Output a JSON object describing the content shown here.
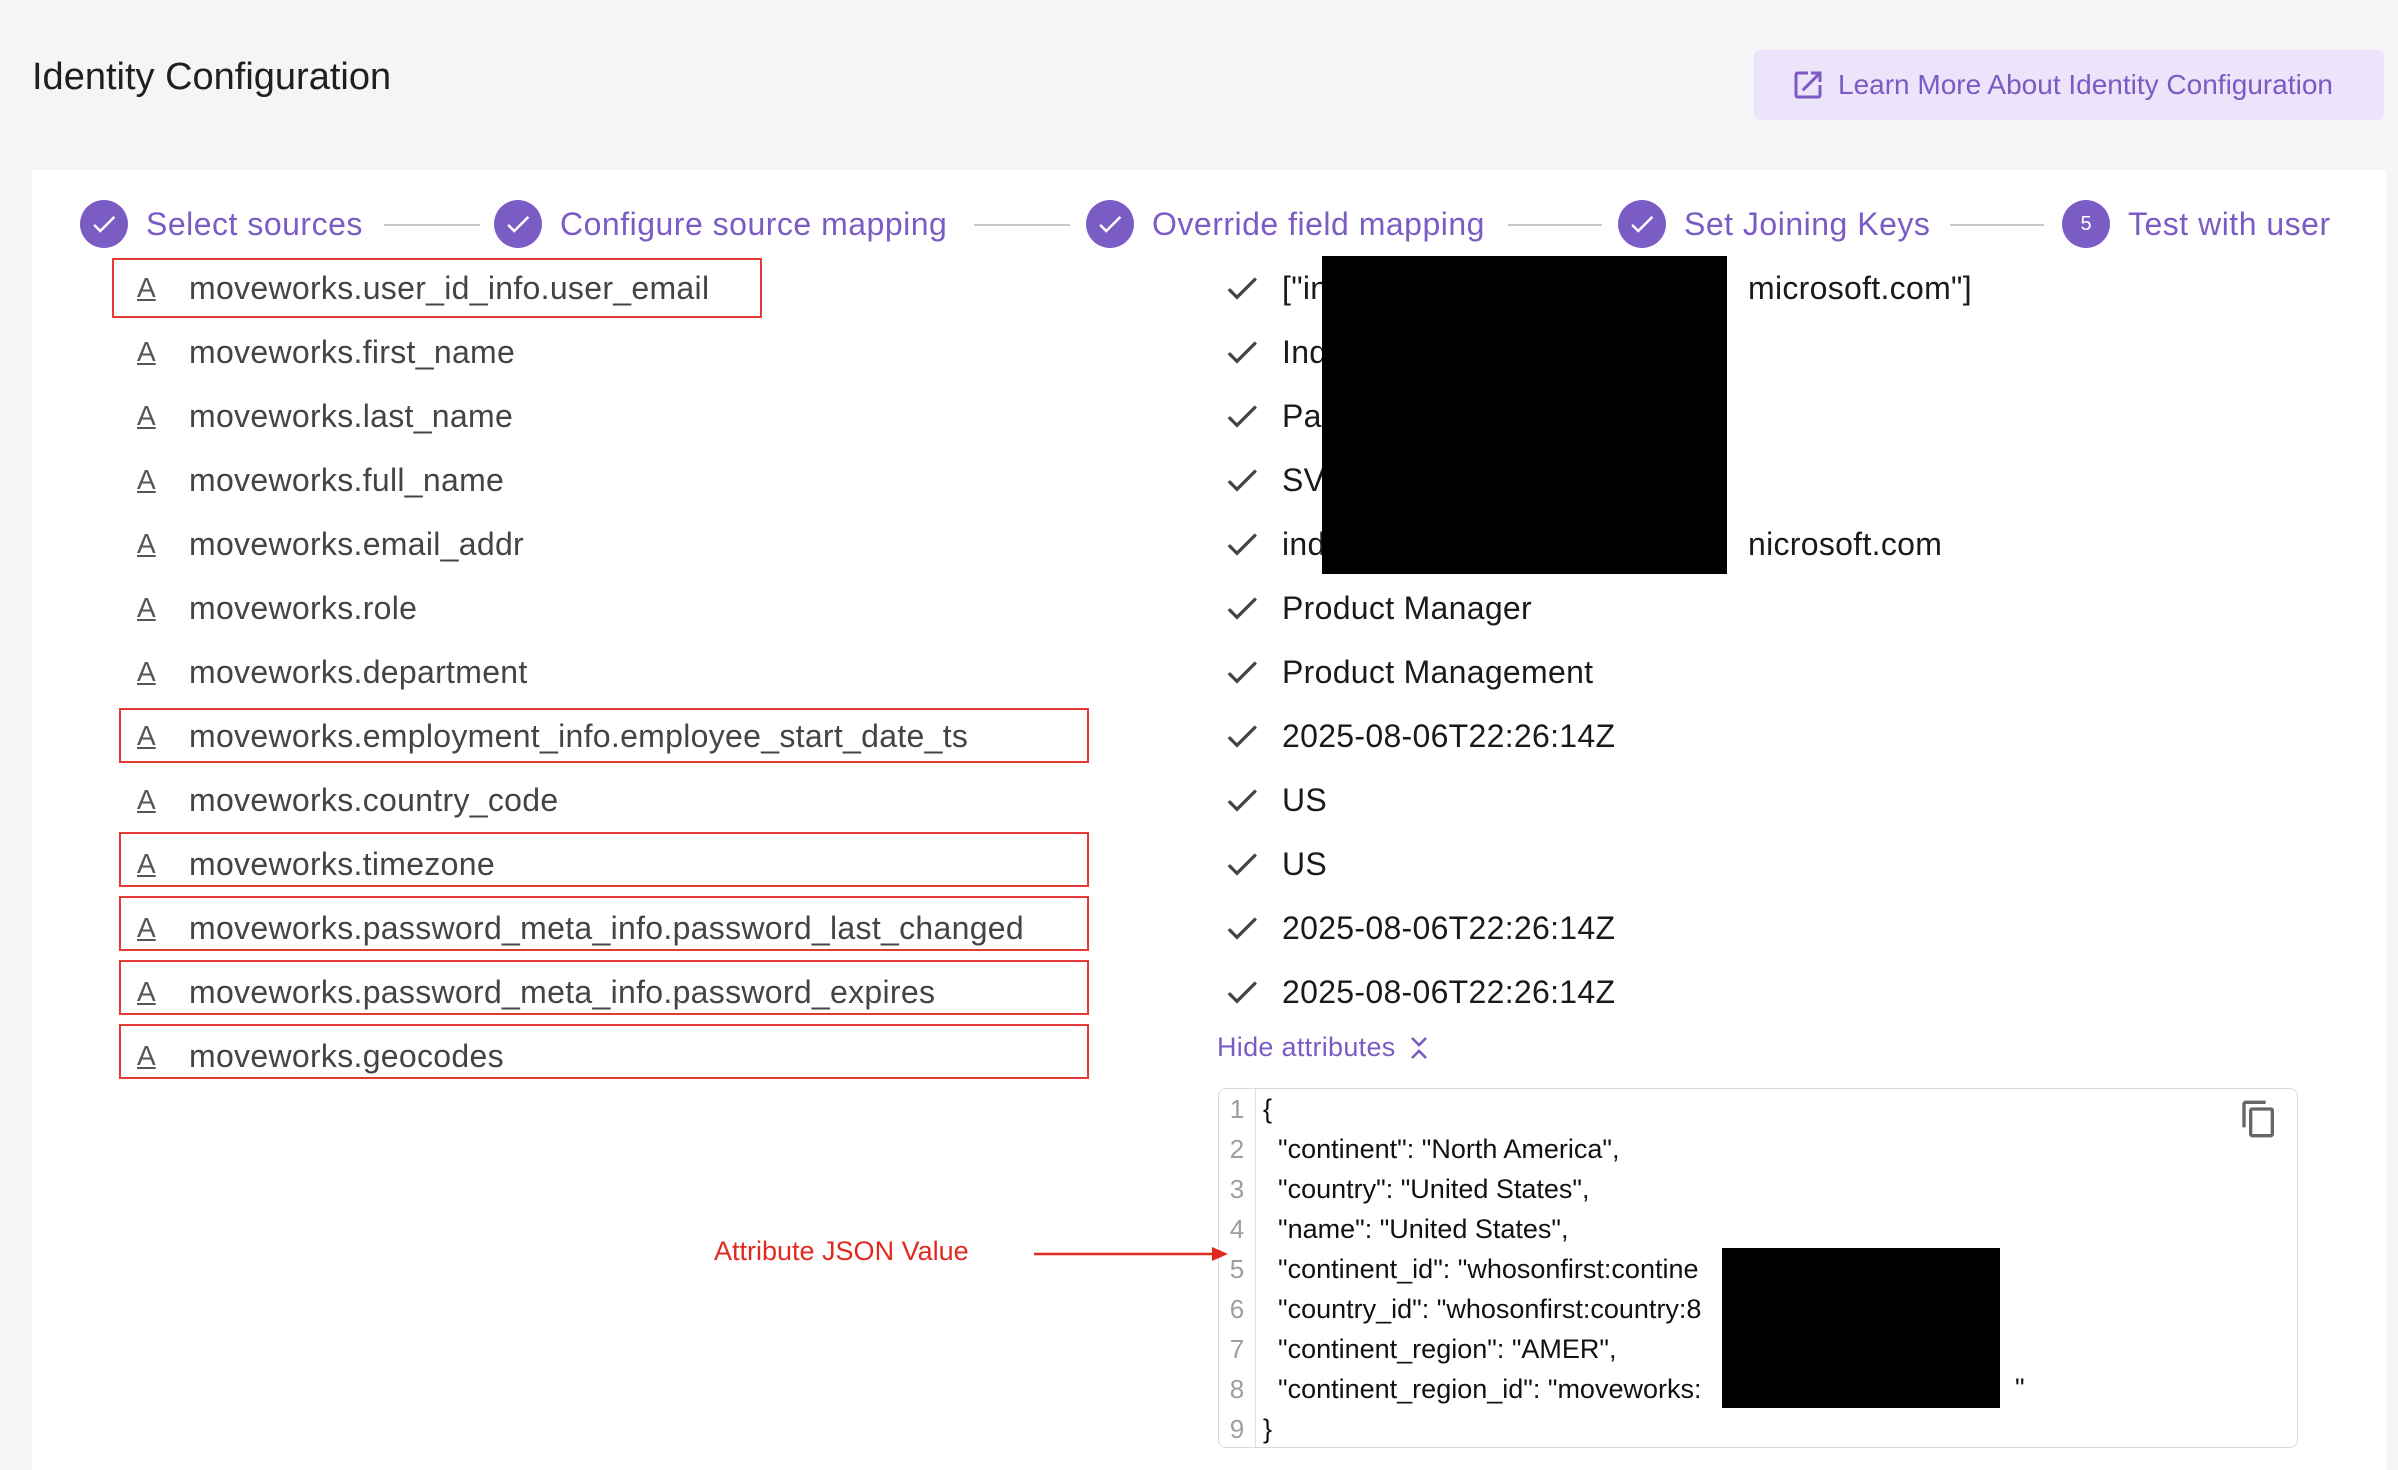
{
  "page": {
    "title": "Identity Configuration",
    "learn_more_label": "Learn More About Identity Configuration"
  },
  "stepper": {
    "steps": [
      {
        "label": "Select sources",
        "status": "complete"
      },
      {
        "label": "Configure source mapping",
        "status": "complete"
      },
      {
        "label": "Override field mapping",
        "status": "complete"
      },
      {
        "label": "Set Joining Keys",
        "status": "complete"
      },
      {
        "label": "Test with user",
        "status": "active",
        "number": "5"
      }
    ]
  },
  "attributes": {
    "type_glyph": "A",
    "rows": [
      {
        "name": "moveworks.user_id_info.user_email",
        "value": "[\"in",
        "value_suffix": "microsoft.com\"]",
        "highlighted": true
      },
      {
        "name": "moveworks.first_name",
        "value": "Ind",
        "value_suffix": "",
        "highlighted": false
      },
      {
        "name": "moveworks.last_name",
        "value": "Pa",
        "value_suffix": "",
        "highlighted": false
      },
      {
        "name": "moveworks.full_name",
        "value": "SV",
        "value_suffix": "",
        "highlighted": false
      },
      {
        "name": "moveworks.email_addr",
        "value": "ind",
        "value_suffix": "nicrosoft.com",
        "highlighted": false
      },
      {
        "name": "moveworks.role",
        "value": "Product Manager",
        "value_suffix": "",
        "highlighted": false
      },
      {
        "name": "moveworks.department",
        "value": "Product Management",
        "value_suffix": "",
        "highlighted": false
      },
      {
        "name": "moveworks.employment_info.employee_start_date_ts",
        "value": "2025-08-06T22:26:14Z",
        "value_suffix": "",
        "highlighted": true
      },
      {
        "name": "moveworks.country_code",
        "value": "US",
        "value_suffix": "",
        "highlighted": false
      },
      {
        "name": "moveworks.timezone",
        "value": "US",
        "value_suffix": "",
        "highlighted": true
      },
      {
        "name": "moveworks.password_meta_info.password_last_changed",
        "value": "2025-08-06T22:26:14Z",
        "value_suffix": "",
        "highlighted": true
      },
      {
        "name": "moveworks.password_meta_info.password_expires",
        "value": "2025-08-06T22:26:14Z",
        "value_suffix": "",
        "highlighted": true
      },
      {
        "name": "moveworks.geocodes",
        "value": "",
        "value_suffix": "",
        "highlighted": true
      }
    ]
  },
  "json_viewer": {
    "toggle_label": "Hide attributes",
    "lines": [
      {
        "n": "1",
        "text": "{"
      },
      {
        "n": "2",
        "text": "  \"continent\": \"North America\","
      },
      {
        "n": "3",
        "text": "  \"country\": \"United States\","
      },
      {
        "n": "4",
        "text": "  \"name\": \"United States\","
      },
      {
        "n": "5",
        "text": "  \"continent_id\": \"whosonfirst:contine"
      },
      {
        "n": "6",
        "text": "  \"country_id\": \"whosonfirst:country:8"
      },
      {
        "n": "7",
        "text": "  \"continent_region\": \"AMER\","
      },
      {
        "n": "8",
        "text": "  \"continent_region_id\": \"moveworks:"
      },
      {
        "n": "9",
        "text": "}"
      }
    ],
    "line8_tail": "\""
  },
  "annotation": {
    "label": "Attribute JSON Value"
  },
  "colors": {
    "accent": "#7a5cc4",
    "highlight_border": "#e53935",
    "annotation": "#e02a1f"
  }
}
